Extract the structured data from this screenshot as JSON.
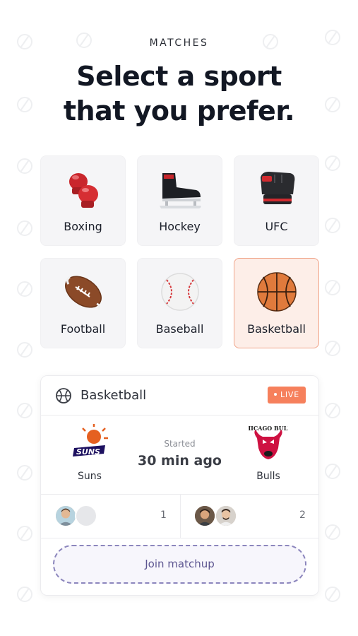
{
  "header": {
    "eyebrow": "MATCHES",
    "title_line1": "Select a sport",
    "title_line2": "that you prefer."
  },
  "sports": [
    {
      "label": "Boxing",
      "icon": "boxing-gloves-icon",
      "selected": false
    },
    {
      "label": "Hockey",
      "icon": "hockey-skate-icon",
      "selected": false
    },
    {
      "label": "UFC",
      "icon": "mma-glove-icon",
      "selected": false
    },
    {
      "label": "Football",
      "icon": "football-icon",
      "selected": false
    },
    {
      "label": "Baseball",
      "icon": "baseball-icon",
      "selected": false
    },
    {
      "label": "Basketball",
      "icon": "basketball-icon",
      "selected": true
    }
  ],
  "match_card": {
    "sport": "Basketball",
    "badge": "LIVE",
    "home_team": {
      "name": "Suns",
      "logo_text": "SUNS"
    },
    "away_team": {
      "name": "Bulls",
      "logo_text": "CHICAGO BULLS"
    },
    "status_label": "Started",
    "status_time": "30 min ago",
    "home_players_count": "1",
    "away_players_count": "2",
    "join_label": "Join matchup"
  },
  "colors": {
    "accent": "#f6805c",
    "selected_bg": "#fdeee8",
    "join_border": "#8c86bd"
  }
}
